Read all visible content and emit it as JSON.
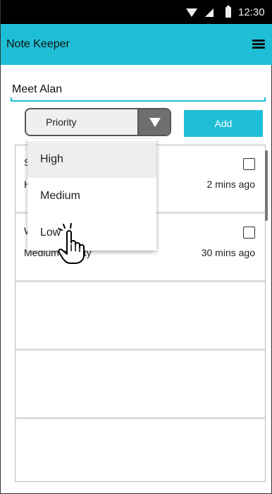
{
  "status_bar": {
    "time": "12:30"
  },
  "app_bar": {
    "title": "Note Keeper"
  },
  "note_input": {
    "value": "Meet Alan"
  },
  "priority_select": {
    "label": "Priority"
  },
  "add_button": {
    "label": "Add"
  },
  "notes": [
    {
      "title_visible": "S",
      "subtitle_visible": "H",
      "time": "2 mins ago",
      "checked": false
    },
    {
      "title_visible": "W",
      "subtitle_visible": "Medium priority",
      "time": "30 mins ago",
      "checked": false
    }
  ],
  "dropdown": {
    "options": [
      {
        "label": "High",
        "highlighted": true
      },
      {
        "label": "Medium",
        "highlighted": false
      },
      {
        "label": "Low",
        "highlighted": false
      }
    ]
  },
  "colors": {
    "accent": "#1ebfd6",
    "status_bar": "#000000",
    "select_arrow_box": "#6f6f6f"
  },
  "icons": {
    "menu": "hamburger-menu-icon",
    "wifi": "wifi-icon",
    "signal": "signal-icon",
    "battery": "battery-icon",
    "cursor": "hand-pointer-cursor"
  }
}
